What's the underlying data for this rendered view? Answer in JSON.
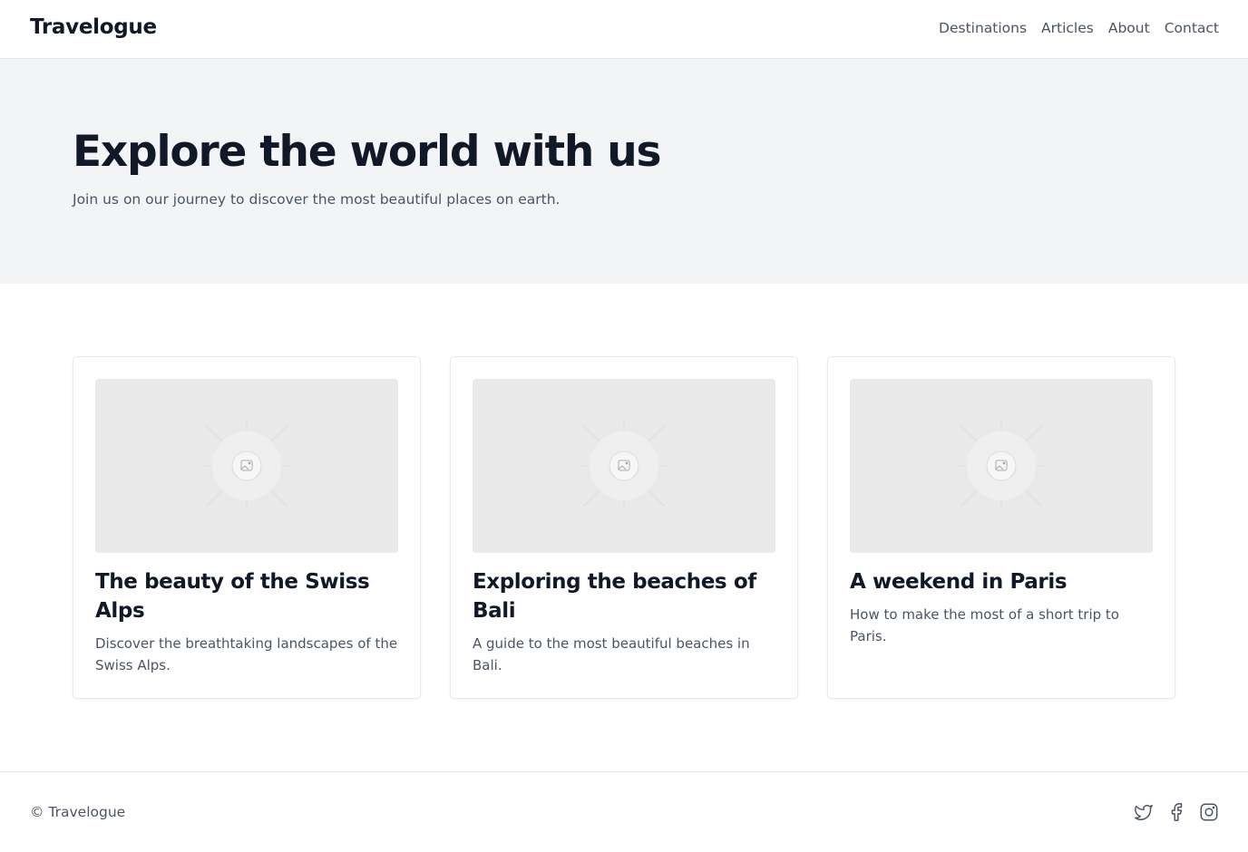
{
  "header": {
    "brand": "Travelogue",
    "nav": [
      "Destinations",
      "Articles",
      "About",
      "Contact"
    ]
  },
  "hero": {
    "title": "Explore the world with us",
    "subtitle": "Join us on our journey to discover the most beautiful places on earth."
  },
  "cards": [
    {
      "title": "The beauty of the Swiss Alps",
      "description": "Discover the breathtaking landscapes of the Swiss Alps.",
      "image_icon": "image-placeholder-icon"
    },
    {
      "title": "Exploring the beaches of Bali",
      "description": "A guide to the most beautiful beaches in Bali.",
      "image_icon": "image-placeholder-icon"
    },
    {
      "title": "A weekend in Paris",
      "description": "How to make the most of a short trip to Paris.",
      "image_icon": "image-placeholder-icon"
    }
  ],
  "footer": {
    "copyright": "© Travelogue",
    "socials": [
      "twitter-icon",
      "facebook-icon",
      "instagram-icon"
    ]
  },
  "colors": {
    "text_primary": "#111827",
    "text_secondary": "#4b5563",
    "hero_background": "#f3f4f6",
    "border": "#e5e7eb",
    "image_placeholder": "#e9e9e9"
  }
}
